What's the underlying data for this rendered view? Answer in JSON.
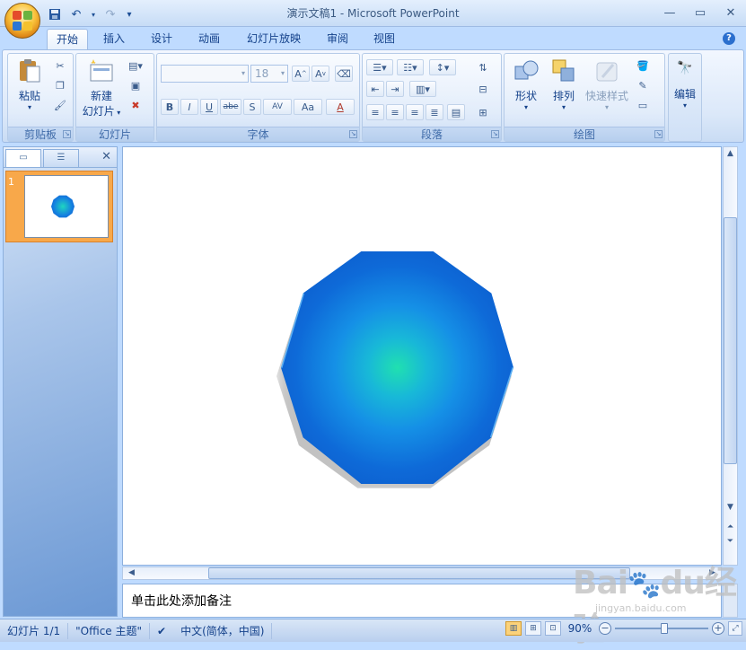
{
  "window": {
    "title": "演示文稿1 - Microsoft PowerPoint",
    "controls": [
      "minimize-icon",
      "restore-icon",
      "close-icon"
    ]
  },
  "quick_access": [
    "save-icon",
    "undo-icon",
    "redo-icon",
    "customize-icon"
  ],
  "ribbon_tabs": [
    "开始",
    "插入",
    "设计",
    "动画",
    "幻灯片放映",
    "审阅",
    "视图"
  ],
  "active_tab": "开始",
  "ribbon": {
    "clipboard": {
      "label": "剪贴板",
      "paste": "粘贴"
    },
    "slides": {
      "label": "幻灯片",
      "new_slide_line1": "新建",
      "new_slide_line2": "幻灯片"
    },
    "font": {
      "label": "字体",
      "font_name": "",
      "font_size": "18",
      "buttons": [
        "B",
        "I",
        "U",
        "abe",
        "S",
        "AV",
        "Aa",
        "A"
      ]
    },
    "paragraph": {
      "label": "段落"
    },
    "drawing": {
      "label": "绘图",
      "shapes": "形状",
      "arrange": "排列",
      "quick_styles": "快速样式"
    },
    "editing": {
      "label": "编辑"
    }
  },
  "panel": {
    "tabs": [
      "slides-tab",
      "outline-tab"
    ],
    "slide_number": "1"
  },
  "notes_placeholder": "单击此处添加备注",
  "status": {
    "slide": "幻灯片 1/1",
    "theme": "\"Office 主题\"",
    "language": "中文(简体，中国)",
    "zoom": "90%",
    "zoom_level": 0.53
  },
  "watermark": {
    "text": "Baidu经验",
    "sub": "jingyan.baidu.com"
  },
  "colors": {
    "shape_center": "#20e0b0",
    "shape_edge": "#0a52c4",
    "accent": "#15428b"
  }
}
